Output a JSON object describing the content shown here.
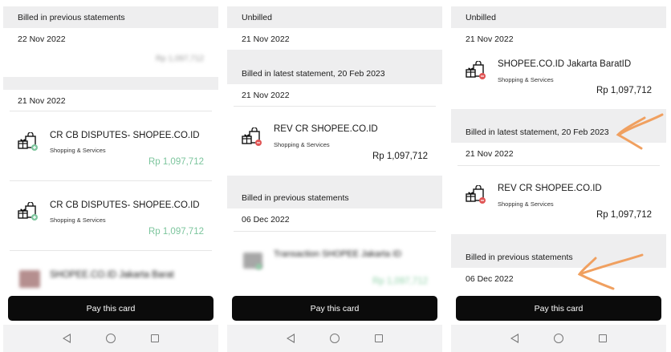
{
  "accent_colors": {
    "credit_green": "#7cc59d",
    "annotation_orange": "#f0a060",
    "pay_button": "#0b0b0b"
  },
  "panel1": {
    "header": "Billed in previous statements",
    "date1": "22 Nov 2022",
    "blurred_amount": "Rp 1,097,712",
    "date2": "21 Nov 2022",
    "transactions": [
      {
        "name": "CR CB DISPUTES- SHOPEE.CO.ID",
        "category": "Shopping & Services",
        "amount": "Rp 1,097,712",
        "icon": "shopping-bag-credit-icon"
      },
      {
        "name": "CR CB DISPUTES- SHOPEE.CO.ID",
        "category": "Shopping & Services",
        "amount": "Rp 1,097,712",
        "icon": "shopping-bag-credit-icon"
      }
    ],
    "blurred_tx_name": "SHOPEE.CO.ID Jakarta Barat",
    "pay_label": "Pay this card"
  },
  "panel2": {
    "header": "Unbilled",
    "date1": "21 Nov 2022",
    "section2_header": "Billed in latest statement, 20 Feb 2023",
    "date2": "21 Nov 2022",
    "transaction": {
      "name": "REV CR SHOPEE.CO.ID",
      "category": "Shopping & Services",
      "amount": "Rp 1,097,712",
      "icon": "shopping-bag-debit-icon"
    },
    "section3_header": "Billed in previous statements",
    "date3": "06 Dec 2022",
    "blurred_tx_name": "Transaction SHOPEE Jakarta ID",
    "blurred_amount": "Rp 1,097,712",
    "pay_label": "Pay this card"
  },
  "panel3": {
    "header": "Unbilled",
    "date1": "21 Nov 2022",
    "transaction1": {
      "name": "SHOPEE.CO.ID Jakarta BaratID",
      "category": "Shopping & Services",
      "amount": "Rp 1,097,712",
      "icon": "shopping-bag-debit-icon"
    },
    "section2_header": "Billed in latest statement, 20 Feb 2023",
    "date2": "21 Nov 2022",
    "transaction2": {
      "name": "REV CR SHOPEE.CO.ID",
      "category": "Shopping & Services",
      "amount": "Rp 1,097,712",
      "icon": "shopping-bag-debit-icon"
    },
    "section3_header": "Billed in previous statements",
    "date3": "06 Dec 2022",
    "pay_label": "Pay this card"
  }
}
